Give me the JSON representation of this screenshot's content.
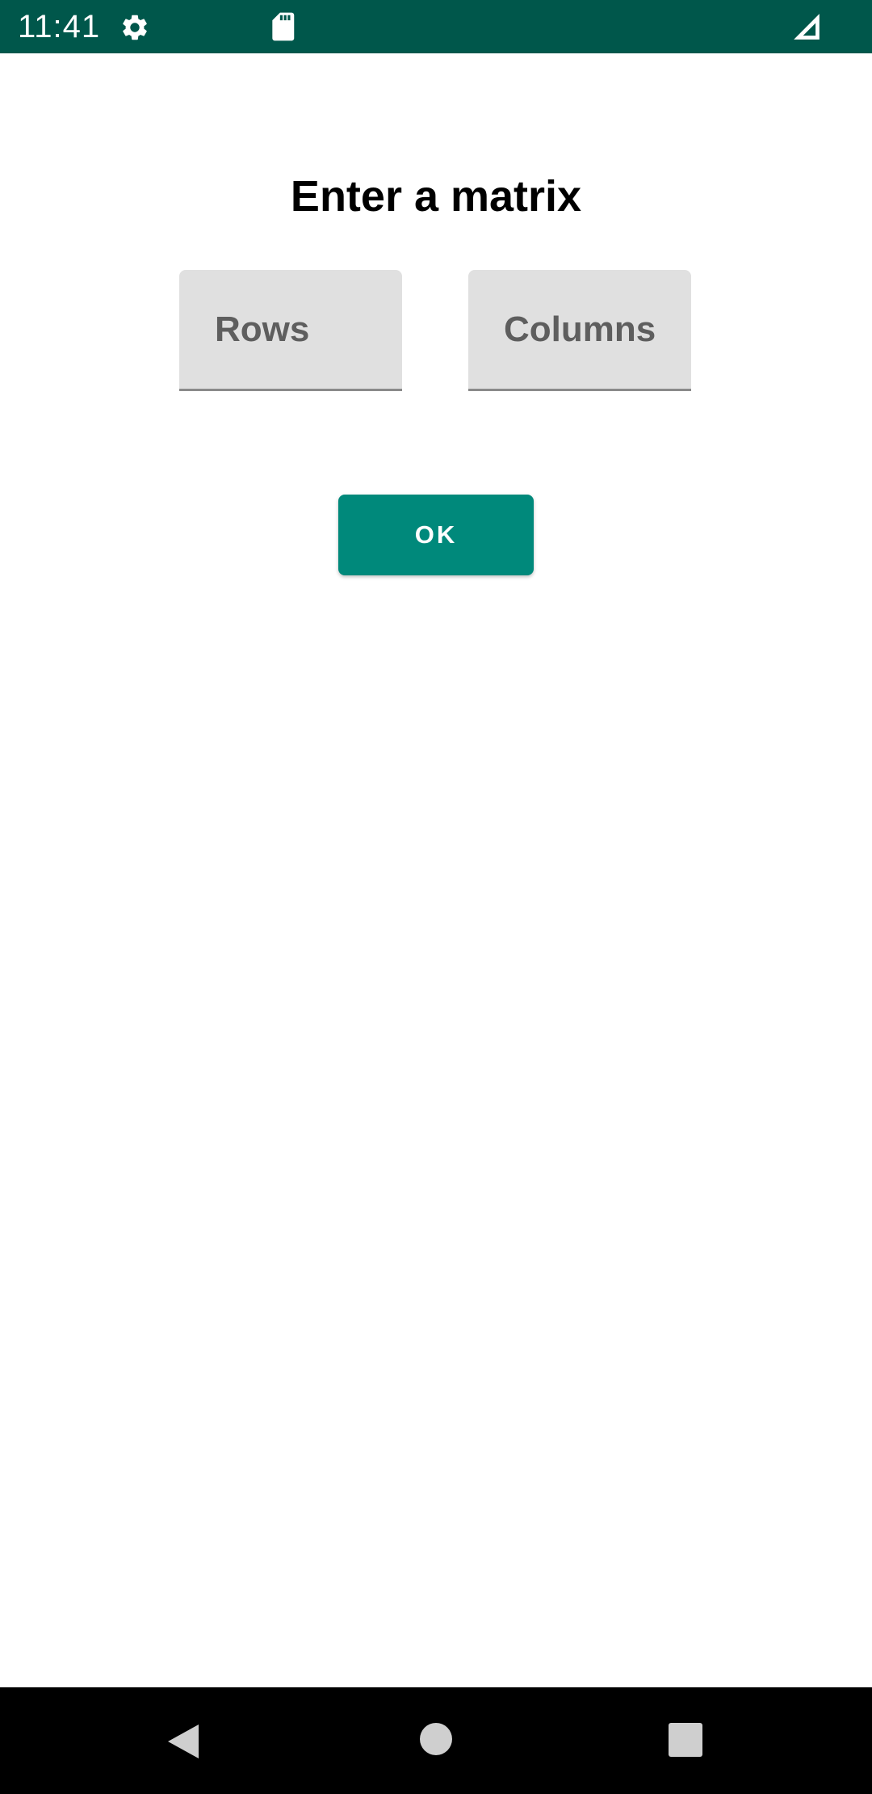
{
  "status_bar": {
    "time": "11:41",
    "icons": [
      "settings-icon",
      "sd-card-icon",
      "signal-icon"
    ]
  },
  "main": {
    "title": "Enter a matrix",
    "rows_field": {
      "placeholder": "Rows",
      "value": ""
    },
    "columns_field": {
      "placeholder": "Columns",
      "value": ""
    },
    "ok_button_label": "OK"
  },
  "navigation_bar": {
    "buttons": [
      "back-icon",
      "home-icon",
      "recents-icon"
    ]
  },
  "colors": {
    "status_bar": "#00574b",
    "accent": "#00897b",
    "field_background": "#e0e0e0",
    "navigation_bar": "#000000"
  }
}
